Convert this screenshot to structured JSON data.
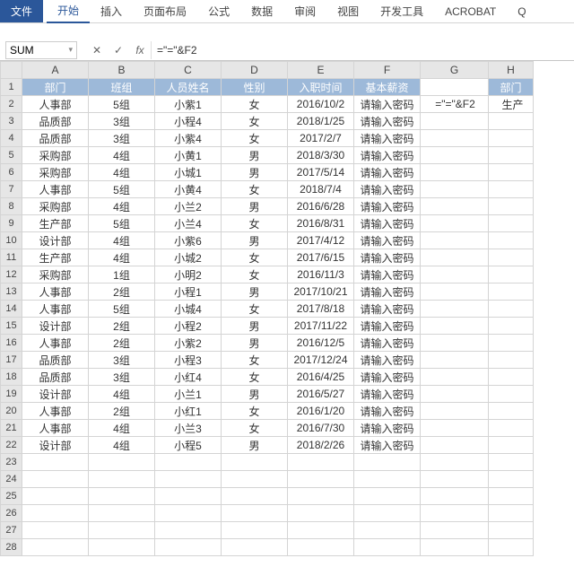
{
  "ribbon": {
    "tabs": [
      "文件",
      "开始",
      "插入",
      "页面布局",
      "公式",
      "数据",
      "审阅",
      "视图",
      "开发工具",
      "ACROBAT"
    ],
    "active": "开始",
    "help_icon": "Q"
  },
  "formula_bar": {
    "name_box": "SUM",
    "cancel": "✕",
    "enter": "✓",
    "fx": "fx",
    "formula": "=\"=\"&F2"
  },
  "columns": [
    "A",
    "B",
    "C",
    "D",
    "E",
    "F",
    "G",
    "H"
  ],
  "header_row": [
    "部门",
    "班组",
    "人员姓名",
    "性别",
    "入职时间",
    "基本薪资",
    "",
    "部门"
  ],
  "g2": "=\"=\"&F2",
  "h2": "生产",
  "chart_data": {
    "type": "table",
    "columns": [
      "部门",
      "班组",
      "人员姓名",
      "性别",
      "入职时间",
      "基本薪资"
    ],
    "rows": [
      [
        "人事部",
        "5组",
        "小紫1",
        "女",
        "2016/10/2",
        "请输入密码"
      ],
      [
        "品质部",
        "3组",
        "小程4",
        "女",
        "2018/1/25",
        "请输入密码"
      ],
      [
        "品质部",
        "3组",
        "小紫4",
        "女",
        "2017/2/7",
        "请输入密码"
      ],
      [
        "采购部",
        "4组",
        "小黄1",
        "男",
        "2018/3/30",
        "请输入密码"
      ],
      [
        "采购部",
        "4组",
        "小城1",
        "男",
        "2017/5/14",
        "请输入密码"
      ],
      [
        "人事部",
        "5组",
        "小黄4",
        "女",
        "2018/7/4",
        "请输入密码"
      ],
      [
        "采购部",
        "4组",
        "小兰2",
        "男",
        "2016/6/28",
        "请输入密码"
      ],
      [
        "生产部",
        "5组",
        "小兰4",
        "女",
        "2016/8/31",
        "请输入密码"
      ],
      [
        "设计部",
        "4组",
        "小紫6",
        "男",
        "2017/4/12",
        "请输入密码"
      ],
      [
        "生产部",
        "4组",
        "小城2",
        "女",
        "2017/6/15",
        "请输入密码"
      ],
      [
        "采购部",
        "1组",
        "小明2",
        "女",
        "2016/11/3",
        "请输入密码"
      ],
      [
        "人事部",
        "2组",
        "小程1",
        "男",
        "2017/10/21",
        "请输入密码"
      ],
      [
        "人事部",
        "5组",
        "小城4",
        "女",
        "2017/8/18",
        "请输入密码"
      ],
      [
        "设计部",
        "2组",
        "小程2",
        "男",
        "2017/11/22",
        "请输入密码"
      ],
      [
        "人事部",
        "2组",
        "小紫2",
        "男",
        "2016/12/5",
        "请输入密码"
      ],
      [
        "品质部",
        "3组",
        "小程3",
        "女",
        "2017/12/24",
        "请输入密码"
      ],
      [
        "品质部",
        "3组",
        "小红4",
        "女",
        "2016/4/25",
        "请输入密码"
      ],
      [
        "设计部",
        "4组",
        "小兰1",
        "男",
        "2016/5/27",
        "请输入密码"
      ],
      [
        "人事部",
        "2组",
        "小红1",
        "女",
        "2016/1/20",
        "请输入密码"
      ],
      [
        "人事部",
        "4组",
        "小兰3",
        "女",
        "2016/7/30",
        "请输入密码"
      ],
      [
        "设计部",
        "4组",
        "小程5",
        "男",
        "2018/2/26",
        "请输入密码"
      ]
    ]
  },
  "empty_rows": [
    23,
    24,
    25,
    26,
    27,
    28
  ]
}
